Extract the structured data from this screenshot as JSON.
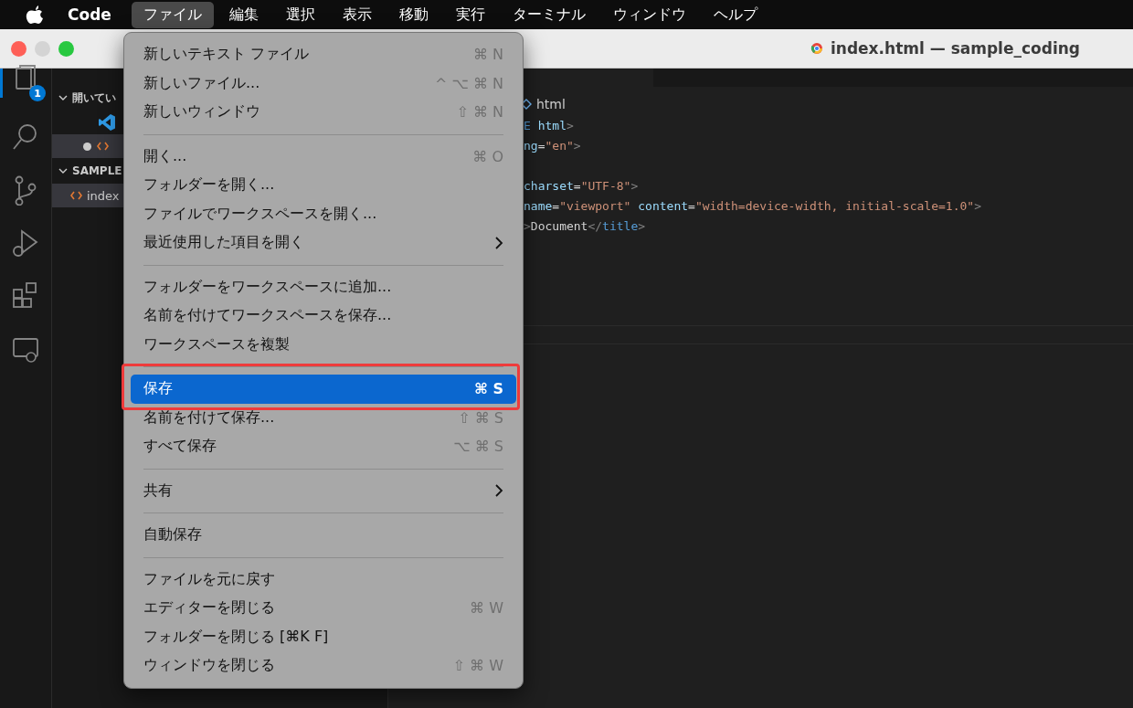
{
  "menubar": {
    "app": "Code",
    "items": [
      {
        "label": "ファイル",
        "selected": true
      },
      {
        "label": "編集",
        "selected": false
      },
      {
        "label": "選択",
        "selected": false
      },
      {
        "label": "表示",
        "selected": false
      },
      {
        "label": "移動",
        "selected": false
      },
      {
        "label": "実行",
        "selected": false
      },
      {
        "label": "ターミナル",
        "selected": false
      },
      {
        "label": "ウィンドウ",
        "selected": false
      },
      {
        "label": "ヘルプ",
        "selected": false
      }
    ]
  },
  "window": {
    "title": "index.html — sample_coding"
  },
  "activity_bar": {
    "badge": "1"
  },
  "sidebar": {
    "rows": [
      {
        "kind": "header",
        "label": "開いてい",
        "selected": false
      },
      {
        "kind": "vscode",
        "selected": false
      },
      {
        "kind": "modified",
        "selected": true
      },
      {
        "kind": "header",
        "label": "SAMPLE",
        "selected": false
      },
      {
        "kind": "file",
        "label": "index",
        "selected": true
      }
    ]
  },
  "editor": {
    "breadcrumb": "html",
    "lines": [
      {
        "kind": "code",
        "tokens": [
          {
            "t": "E",
            "kind": "tag"
          },
          {
            "t": " html",
            "kind": "attr"
          },
          {
            "t": ">",
            "kind": "punct"
          }
        ]
      },
      {
        "kind": "code",
        "tokens": [
          {
            "t": "ng",
            "kind": "attr"
          },
          {
            "t": "=",
            "kind": "text"
          },
          {
            "t": "\"en\"",
            "kind": "string"
          },
          {
            "t": ">",
            "kind": "punct"
          }
        ]
      },
      {
        "kind": "blank"
      },
      {
        "kind": "code",
        "tokens": [
          {
            "t": "charset",
            "kind": "attr"
          },
          {
            "t": "=",
            "kind": "text"
          },
          {
            "t": "\"UTF-8\"",
            "kind": "string"
          },
          {
            "t": ">",
            "kind": "punct"
          }
        ]
      },
      {
        "kind": "code",
        "tokens": [
          {
            "t": "name",
            "kind": "attr"
          },
          {
            "t": "=",
            "kind": "text"
          },
          {
            "t": "\"viewport\"",
            "kind": "string"
          },
          {
            "t": " content",
            "kind": "attr"
          },
          {
            "t": "=",
            "kind": "text"
          },
          {
            "t": "\"width=device-width, initial-scale=1.0\"",
            "kind": "string"
          },
          {
            "t": ">",
            "kind": "punct"
          }
        ]
      },
      {
        "kind": "code",
        "tokens": [
          {
            "t": ">",
            "kind": "punct"
          },
          {
            "t": "Document",
            "kind": "text"
          },
          {
            "t": "</",
            "kind": "punct"
          },
          {
            "t": "title",
            "kind": "tag"
          },
          {
            "t": ">",
            "kind": "punct"
          }
        ]
      }
    ]
  },
  "file_menu": {
    "items": [
      {
        "kind": "item",
        "label": "新しいテキスト ファイル",
        "shortcut": "⌘ N",
        "selected": false
      },
      {
        "kind": "item",
        "label": "新しいファイル...",
        "shortcut": "^ ⌥ ⌘ N",
        "selected": false
      },
      {
        "kind": "item",
        "label": "新しいウィンドウ",
        "shortcut": "⇧ ⌘ N",
        "selected": false
      },
      {
        "kind": "separator"
      },
      {
        "kind": "item",
        "label": "開く...",
        "shortcut": "⌘ O",
        "selected": false
      },
      {
        "kind": "item",
        "label": "フォルダーを開く...",
        "selected": false
      },
      {
        "kind": "item",
        "label": "ファイルでワークスペースを開く...",
        "selected": false
      },
      {
        "kind": "submenu",
        "label": "最近使用した項目を開く",
        "selected": false
      },
      {
        "kind": "separator"
      },
      {
        "kind": "item",
        "label": "フォルダーをワークスペースに追加...",
        "selected": false
      },
      {
        "kind": "item",
        "label": "名前を付けてワークスペースを保存...",
        "selected": false
      },
      {
        "kind": "item",
        "label": "ワークスペースを複製",
        "selected": false
      },
      {
        "kind": "separator"
      },
      {
        "kind": "item",
        "label": "保存",
        "shortcut": "⌘ S",
        "selected": true,
        "highlighted": true
      },
      {
        "kind": "item",
        "label": "名前を付けて保存...",
        "shortcut": "⇧ ⌘ S",
        "selected": false
      },
      {
        "kind": "item",
        "label": "すべて保存",
        "shortcut": "⌥ ⌘ S",
        "selected": false
      },
      {
        "kind": "separator"
      },
      {
        "kind": "submenu",
        "label": "共有",
        "selected": false
      },
      {
        "kind": "separator"
      },
      {
        "kind": "item",
        "label": "自動保存",
        "selected": false
      },
      {
        "kind": "separator"
      },
      {
        "kind": "item",
        "label": "ファイルを元に戻す",
        "selected": false
      },
      {
        "kind": "item",
        "label": "エディターを閉じる",
        "shortcut": "⌘ W",
        "selected": false
      },
      {
        "kind": "item",
        "label": "フォルダーを閉じる [⌘K F]",
        "selected": false
      },
      {
        "kind": "item",
        "label": "ウィンドウを閉じる",
        "shortcut": "⇧ ⌘ W",
        "selected": false
      }
    ]
  }
}
